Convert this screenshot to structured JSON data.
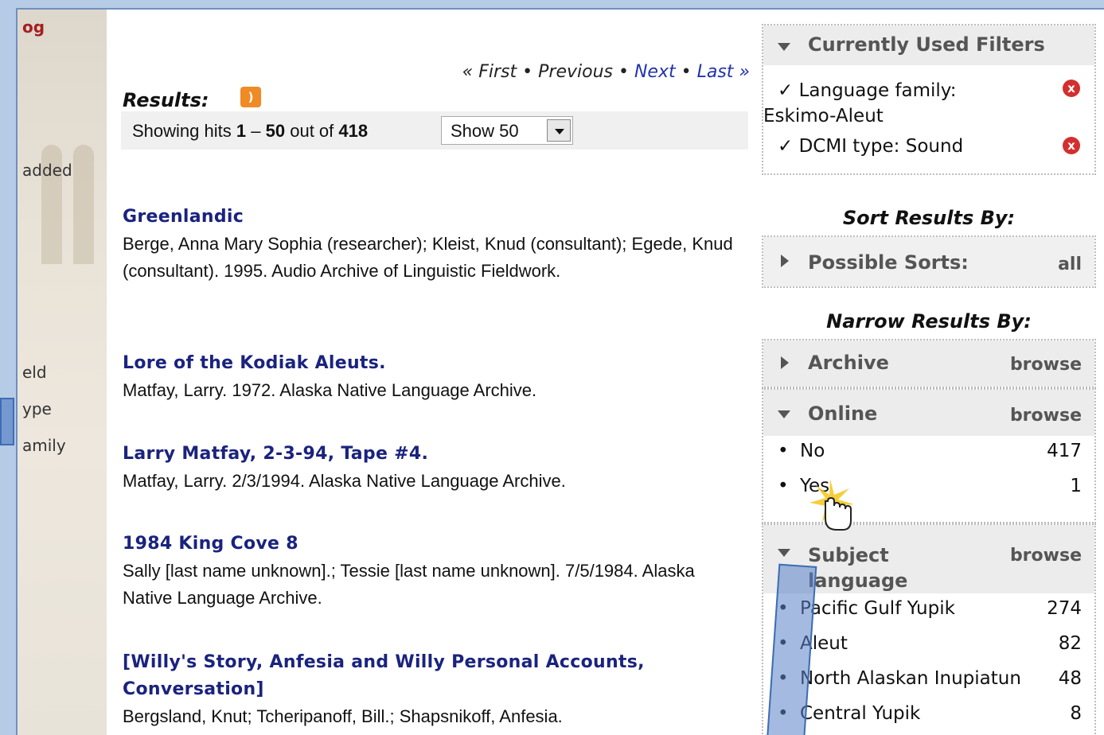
{
  "sidebar": {
    "snippets": [
      "og",
      "added",
      "eld",
      "ype",
      "amily"
    ]
  },
  "pager": {
    "first": "First",
    "previous": "Previous",
    "next": "Next",
    "last": "Last",
    "sep": "•"
  },
  "results": {
    "label": "Results:",
    "hits_prefix": "Showing hits",
    "hits_start": "1",
    "hits_dash": "–",
    "hits_end": "50",
    "hits_outof": "out of",
    "hits_total": "418",
    "show_select_value": "Show 50",
    "items": [
      {
        "title": "Greenlandic",
        "desc": "Berge, Anna Mary Sophia (researcher); Kleist, Knud (consultant); Egede, Knud (consultant). 1995. Audio Archive of Linguistic Fieldwork."
      },
      {
        "title": "Lore of the Kodiak Aleuts.",
        "desc": "Matfay, Larry. 1972. Alaska Native Language Archive."
      },
      {
        "title": "Larry Matfay, 2-3-94, Tape #4.",
        "desc": "Matfay, Larry. 2/3/1994. Alaska Native Language Archive."
      },
      {
        "title": "1984 King Cove 8",
        "desc": "Sally [last name unknown].; Tessie [last name unknown]. 7/5/1984. Alaska Native Language Archive."
      },
      {
        "title": "[Willy's Story, Anfesia and Willy Personal Accounts, Conversation]",
        "desc": "Bergsland, Knut; Tcheripanoff, Bill.; Shapsnikoff, Anfesia."
      }
    ]
  },
  "facets": {
    "current_filters_title": "Currently Used Filters",
    "filters": [
      {
        "check": "✓",
        "line1": "Language family:",
        "line2": "Eskimo-Aleut"
      },
      {
        "check": "✓",
        "line1": "DCMI type: Sound",
        "line2": ""
      }
    ],
    "remove_glyph": "x",
    "sort_label": "Sort Results By:",
    "possible_sorts": "Possible Sorts:",
    "possible_sorts_link": "all",
    "narrow_label": "Narrow Results By:",
    "archive": {
      "title": "Archive",
      "link": "browse"
    },
    "online": {
      "title": "Online",
      "link": "browse",
      "items": [
        {
          "label": "No",
          "count": "417"
        },
        {
          "label": "Yes",
          "count": "1"
        }
      ]
    },
    "subject_language": {
      "title_line1": "Subject",
      "title_line2": "language",
      "link": "browse",
      "items": [
        {
          "label": "Pacific Gulf Yupik",
          "count": "274"
        },
        {
          "label": "Aleut",
          "count": "82"
        },
        {
          "label": "North Alaskan Inupiatun",
          "count": "48"
        },
        {
          "label": "Central Yupik",
          "count": "8"
        }
      ]
    },
    "bullet": "•"
  },
  "icons": {
    "rss": "rss-icon",
    "remove": "remove-filter-icon",
    "cursor": "hand-cursor-icon"
  }
}
